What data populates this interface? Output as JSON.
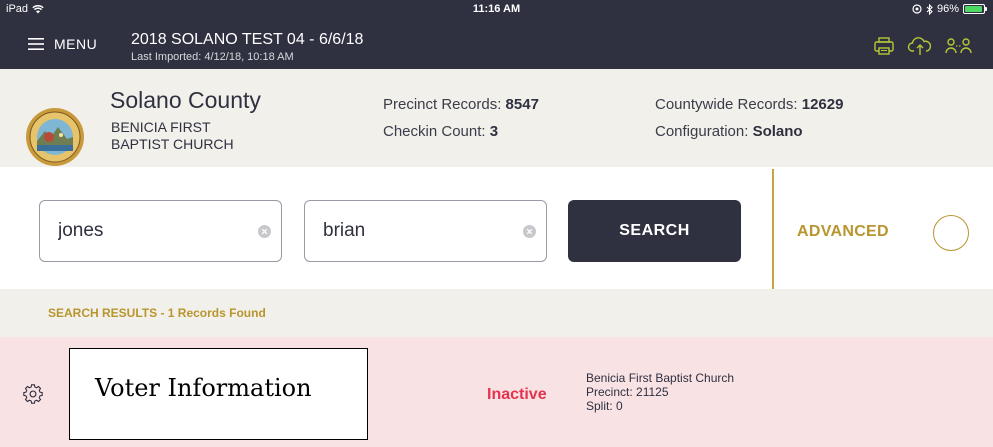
{
  "status_bar": {
    "device": "iPad",
    "time": "11:16 AM",
    "battery": "96%",
    "battery_level": 0.96
  },
  "topbar": {
    "menu_label": "MENU",
    "title": "2018 SOLANO TEST 04 - 6/6/18",
    "subtitle": "Last Imported: 4/12/18, 10:18 AM",
    "icon_color": "#b5c935"
  },
  "info": {
    "county": "Solano County",
    "location_line1": "BENICIA FIRST",
    "location_line2": "BAPTIST CHURCH",
    "precinct_records_label": "Precinct Records:",
    "precinct_records_value": "8547",
    "checkin_count_label": "Checkin Count:",
    "checkin_count_value": "3",
    "countywide_records_label": "Countywide Records:",
    "countywide_records_value": "12629",
    "configuration_label": "Configuration:",
    "configuration_value": "Solano"
  },
  "search": {
    "last_name_value": "jones",
    "first_name_value": "brian",
    "search_button": "SEARCH",
    "advanced_label": "ADVANCED",
    "accent_color": "#b8952e"
  },
  "results": {
    "header": "SEARCH RESULTS - 1 Records Found",
    "items": [
      {
        "voter_info": "Voter Information",
        "status": "Inactive",
        "polling_place": "Benicia First Baptist Church",
        "precinct": "Precinct: 21125",
        "split": "Split: 0"
      }
    ]
  }
}
